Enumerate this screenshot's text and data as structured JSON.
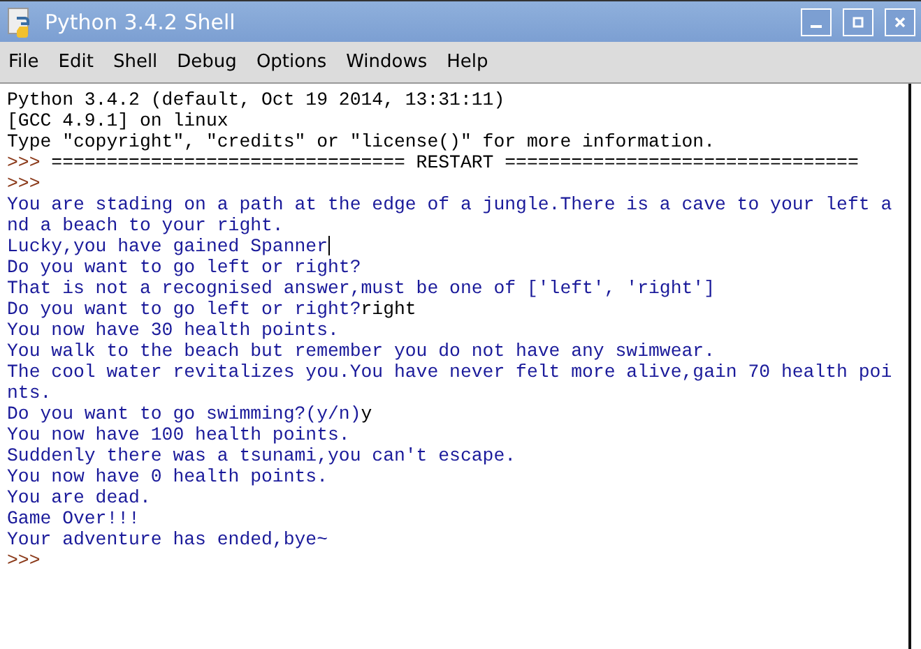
{
  "window": {
    "title": "Python 3.4.2 Shell"
  },
  "menu": [
    "File",
    "Edit",
    "Shell",
    "Debug",
    "Options",
    "Windows",
    "Help"
  ],
  "console": [
    {
      "segments": [
        {
          "kind": "output",
          "text": "Python 3.4.2 (default, Oct 19 2014, 13:31:11)"
        }
      ]
    },
    {
      "segments": [
        {
          "kind": "output",
          "text": "[GCC 4.9.1] on linux"
        }
      ]
    },
    {
      "segments": [
        {
          "kind": "output",
          "text": "Type \"copyright\", \"credits\" or \"license()\" for more information."
        }
      ]
    },
    {
      "segments": [
        {
          "kind": "prompt",
          "text": ">>> "
        },
        {
          "kind": "output",
          "text": "================================ RESTART ================================"
        }
      ]
    },
    {
      "segments": [
        {
          "kind": "prompt",
          "text": ">>> "
        }
      ]
    },
    {
      "segments": [
        {
          "kind": "stdout",
          "text": "You are stading on a path at the edge of a jungle.There is a cave to your left a"
        }
      ]
    },
    {
      "segments": [
        {
          "kind": "stdout",
          "text": "nd a beach to your right."
        }
      ]
    },
    {
      "segments": [
        {
          "kind": "stdout",
          "text": "Lucky,you have gained Spanner",
          "cursor": true
        }
      ]
    },
    {
      "segments": [
        {
          "kind": "stdout",
          "text": "Do you want to go left or right?"
        }
      ]
    },
    {
      "segments": [
        {
          "kind": "stdout",
          "text": "That is not a recognised answer,must be one of ['left', 'right']"
        }
      ]
    },
    {
      "segments": [
        {
          "kind": "stdout",
          "text": "Do you want to go left or right?"
        },
        {
          "kind": "input",
          "text": "right"
        }
      ]
    },
    {
      "segments": [
        {
          "kind": "stdout",
          "text": "You now have 30 health points."
        }
      ]
    },
    {
      "segments": [
        {
          "kind": "stdout",
          "text": "You walk to the beach but remember you do not have any swimwear."
        }
      ]
    },
    {
      "segments": [
        {
          "kind": "stdout",
          "text": "The cool water revitalizes you.You have never felt more alive,gain 70 health poi"
        }
      ]
    },
    {
      "segments": [
        {
          "kind": "stdout",
          "text": "nts."
        }
      ]
    },
    {
      "segments": [
        {
          "kind": "stdout",
          "text": "Do you want to go swimming?(y/n)"
        },
        {
          "kind": "input",
          "text": "y"
        }
      ]
    },
    {
      "segments": [
        {
          "kind": "stdout",
          "text": "You now have 100 health points."
        }
      ]
    },
    {
      "segments": [
        {
          "kind": "stdout",
          "text": "Suddenly there was a tsunami,you can't escape."
        }
      ]
    },
    {
      "segments": [
        {
          "kind": "stdout",
          "text": "You now have 0 health points."
        }
      ]
    },
    {
      "segments": [
        {
          "kind": "stdout",
          "text": "You are dead."
        }
      ]
    },
    {
      "segments": [
        {
          "kind": "stdout",
          "text": "Game Over!!!"
        }
      ]
    },
    {
      "segments": [
        {
          "kind": "stdout",
          "text": "Your adventure has ended,bye~"
        }
      ]
    },
    {
      "segments": [
        {
          "kind": "prompt",
          "text": ">>>"
        }
      ]
    }
  ]
}
